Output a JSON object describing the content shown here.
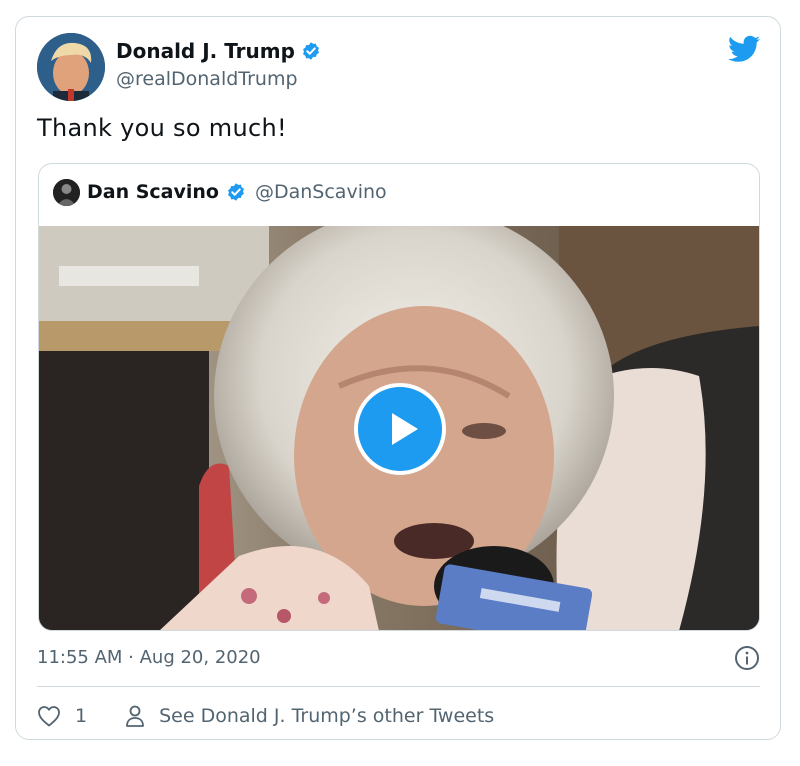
{
  "tweet": {
    "author_name": "Donald J. Trump",
    "author_handle": "@realDonaldTrump",
    "text": "Thank you so much!",
    "timestamp": "11:55 AM · Aug 20, 2020",
    "like_count": "1",
    "other_tweets_label": "See Donald J. Trump’s other Tweets"
  },
  "quoted_tweet": {
    "author_name": "Dan Scavino",
    "author_handle": "@DanScavino"
  },
  "colors": {
    "accent": "#1d9bf0",
    "text": "#0f1419",
    "secondary": "#536471",
    "border": "#cfd9de"
  },
  "icons": [
    "verified-badge-icon",
    "twitter-bird-icon",
    "play-icon",
    "info-icon",
    "heart-icon",
    "person-icon"
  ]
}
